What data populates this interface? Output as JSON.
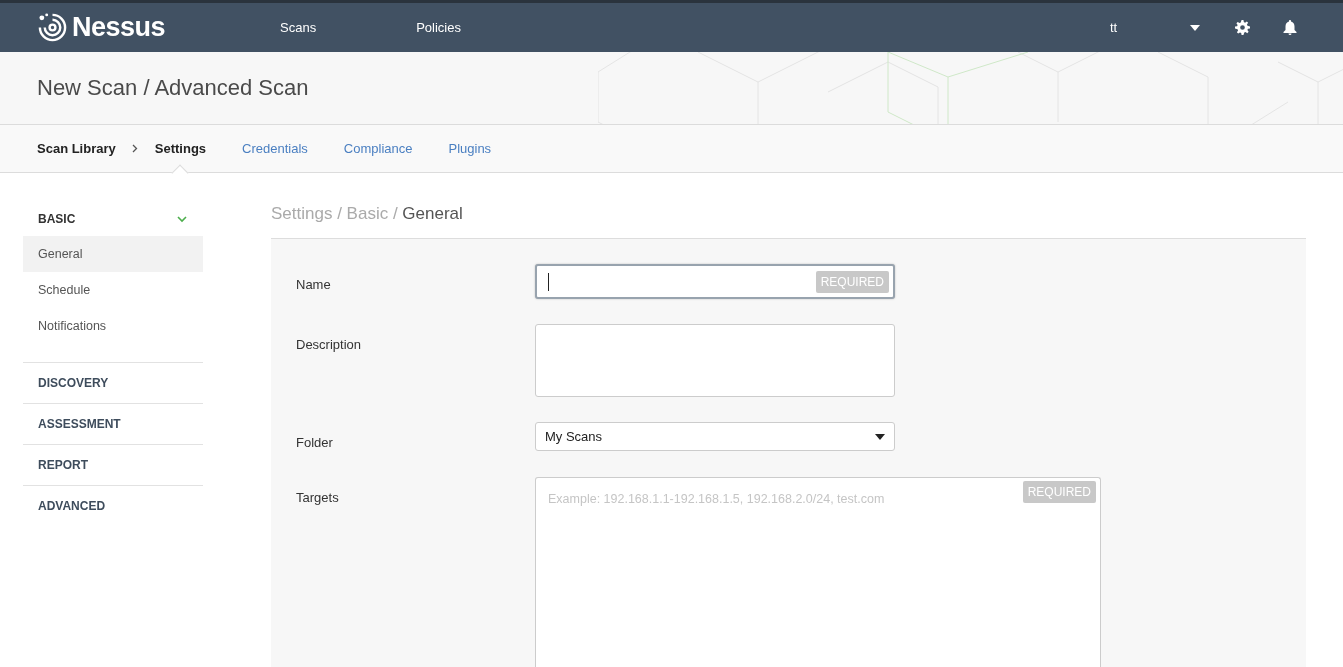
{
  "header": {
    "logo": "Nessus",
    "nav": [
      {
        "label": "Scans"
      },
      {
        "label": "Policies"
      }
    ],
    "user": "tt"
  },
  "page_title": "New Scan / Advanced Scan",
  "tabs": [
    {
      "label": "Scan Library",
      "kind": "crumb",
      "selected": false
    },
    {
      "label": "Settings",
      "kind": "tab",
      "selected": true
    },
    {
      "label": "Credentials",
      "kind": "tab",
      "selected": false
    },
    {
      "label": "Compliance",
      "kind": "tab",
      "selected": false
    },
    {
      "label": "Plugins",
      "kind": "tab",
      "selected": false
    }
  ],
  "sidebar": [
    {
      "label": "BASIC",
      "expanded": true,
      "items": [
        {
          "label": "General",
          "selected": true
        },
        {
          "label": "Schedule",
          "selected": false
        },
        {
          "label": "Notifications",
          "selected": false
        }
      ]
    },
    {
      "label": "DISCOVERY",
      "expanded": false
    },
    {
      "label": "ASSESSMENT",
      "expanded": false
    },
    {
      "label": "REPORT",
      "expanded": false
    },
    {
      "label": "ADVANCED",
      "expanded": false
    }
  ],
  "breadcrumb": {
    "separator": "/",
    "parts": [
      "Settings",
      "Basic",
      "General"
    ]
  },
  "fields": [
    {
      "label": "Name",
      "kind": "text",
      "focused": true,
      "badge": "REQUIRED"
    },
    {
      "label": "Description",
      "kind": "textarea",
      "focused": false
    },
    {
      "label": "Folder",
      "kind": "select",
      "value": "My Scans",
      "focused": false
    },
    {
      "label": "Targets",
      "kind": "targets",
      "focused": false,
      "placeholder": "Example: 192.168.1.1-192.168.1.5, 192.168.2.0/24, test.com",
      "badge": "REQUIRED"
    }
  ]
}
